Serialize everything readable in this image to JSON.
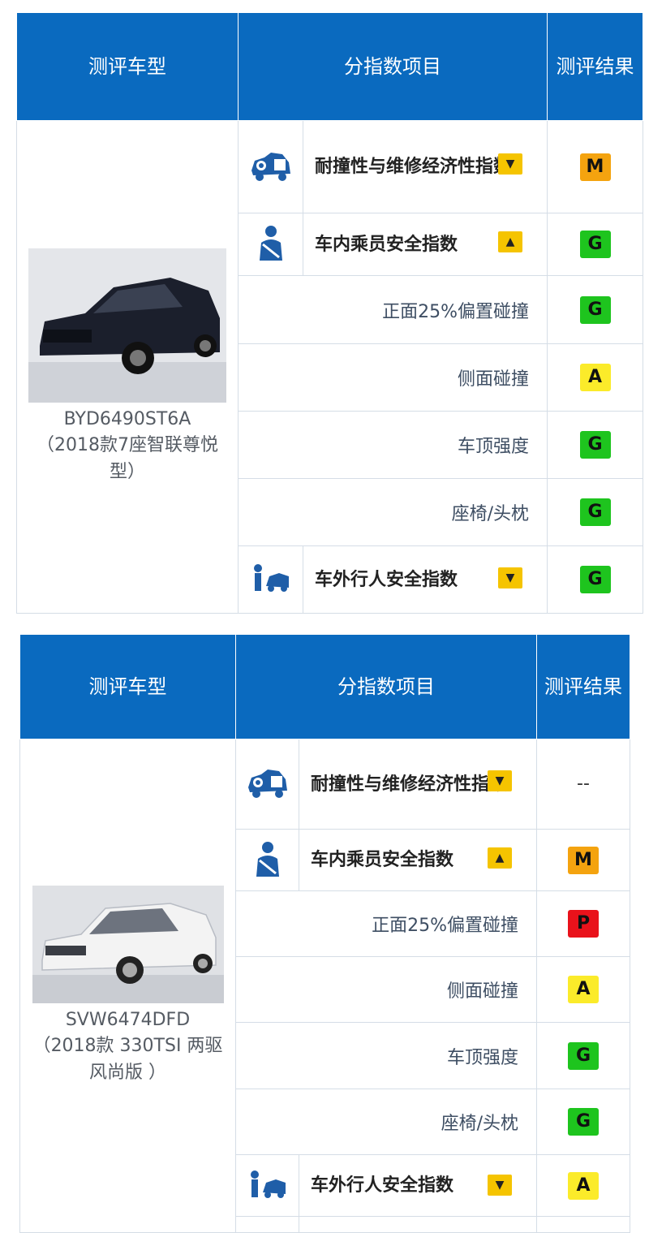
{
  "tables": [
    {
      "headers": {
        "model": "测评车型",
        "items": "分指数项目",
        "result": "测评结果"
      },
      "model": {
        "code": "BYD6490ST6A",
        "desc": "（2018款7座智联尊悦型）",
        "car_color": "#1b1f2c"
      },
      "rows": {
        "repair": {
          "label": "耐撞性与维修经济性指数",
          "icon": "car-repair-icon",
          "toggle": "▼",
          "result": "M"
        },
        "occupant": {
          "label": "车内乘员安全指数",
          "icon": "occupant-safety-icon",
          "toggle": "▲",
          "result": "G"
        },
        "frontal": {
          "label": "正面25%偏置碰撞",
          "result": "G"
        },
        "side": {
          "label": "侧面碰撞",
          "result": "A"
        },
        "roof": {
          "label": "车顶强度",
          "result": "G"
        },
        "seat": {
          "label": "座椅/头枕",
          "result": "G"
        },
        "pedestrian": {
          "label": "车外行人安全指数",
          "icon": "pedestrian-safety-icon",
          "toggle": "▼",
          "result": "G"
        }
      }
    },
    {
      "headers": {
        "model": "测评车型",
        "items": "分指数项目",
        "result": "测评结果"
      },
      "model": {
        "code": "SVW6474DFD",
        "desc": "（2018款 330TSI 两驱风尚版 ）",
        "car_color": "#f2f2f2"
      },
      "rows": {
        "repair": {
          "label": "耐撞性与维修经济性指数",
          "icon": "car-repair-icon",
          "toggle": "▼",
          "result": "--"
        },
        "occupant": {
          "label": "车内乘员安全指数",
          "icon": "occupant-safety-icon",
          "toggle": "▲",
          "result": "M"
        },
        "frontal": {
          "label": "正面25%偏置碰撞",
          "result": "P"
        },
        "side": {
          "label": "侧面碰撞",
          "result": "A"
        },
        "roof": {
          "label": "车顶强度",
          "result": "G"
        },
        "seat": {
          "label": "座椅/头枕",
          "result": "G"
        },
        "pedestrian": {
          "label": "车外行人安全指数",
          "icon": "pedestrian-safety-icon",
          "toggle": "▼",
          "result": "A"
        }
      }
    }
  ],
  "colors": {
    "header_bg": "#0a6abf",
    "icon_blue": "#1f5ea8",
    "badge_G": "#1ec41e",
    "badge_A": "#fbeb2a",
    "badge_M": "#f4a30f",
    "badge_P": "#e9121b",
    "toggle_bg": "#f5c400"
  }
}
